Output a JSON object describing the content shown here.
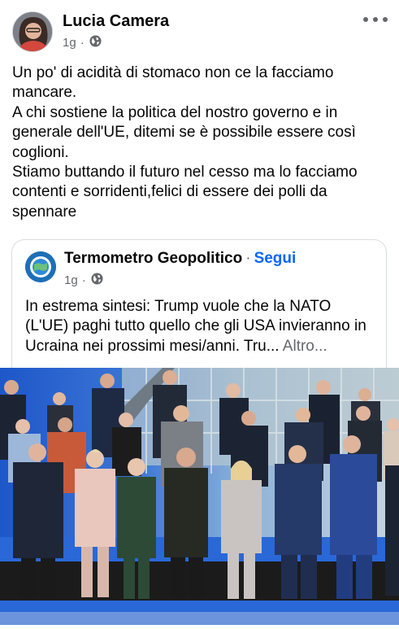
{
  "post": {
    "author": "Lucia Camera",
    "time": "1g",
    "text": "Un po' di acidità di stomaco non ce la facciamo mancare.\nA chi sostiene la politica del nostro governo e in generale dell'UE, ditemi se è possibile essere così coglioni.\nStiamo buttando il futuro nel cesso ma lo facciamo contenti e sorridenti,felici di essere dei polli da spennare"
  },
  "shared": {
    "page_name": "Termometro Geopolitico",
    "separator": "·",
    "follow_label": "Segui",
    "time": "1g",
    "text": "In estrema sintesi: Trump vuole che la NATO (L'UE) paghi tutto quello che gli USA invieranno in Ucraina nei prossimi mesi/anni. Tru...",
    "more_label": "Altro..."
  },
  "icons": {
    "privacy": "globe-icon",
    "menu": "more-options-icon"
  },
  "colors": {
    "link": "#0866ff",
    "secondary_text": "#65676b",
    "stage_blue": "#1f5fd0"
  }
}
